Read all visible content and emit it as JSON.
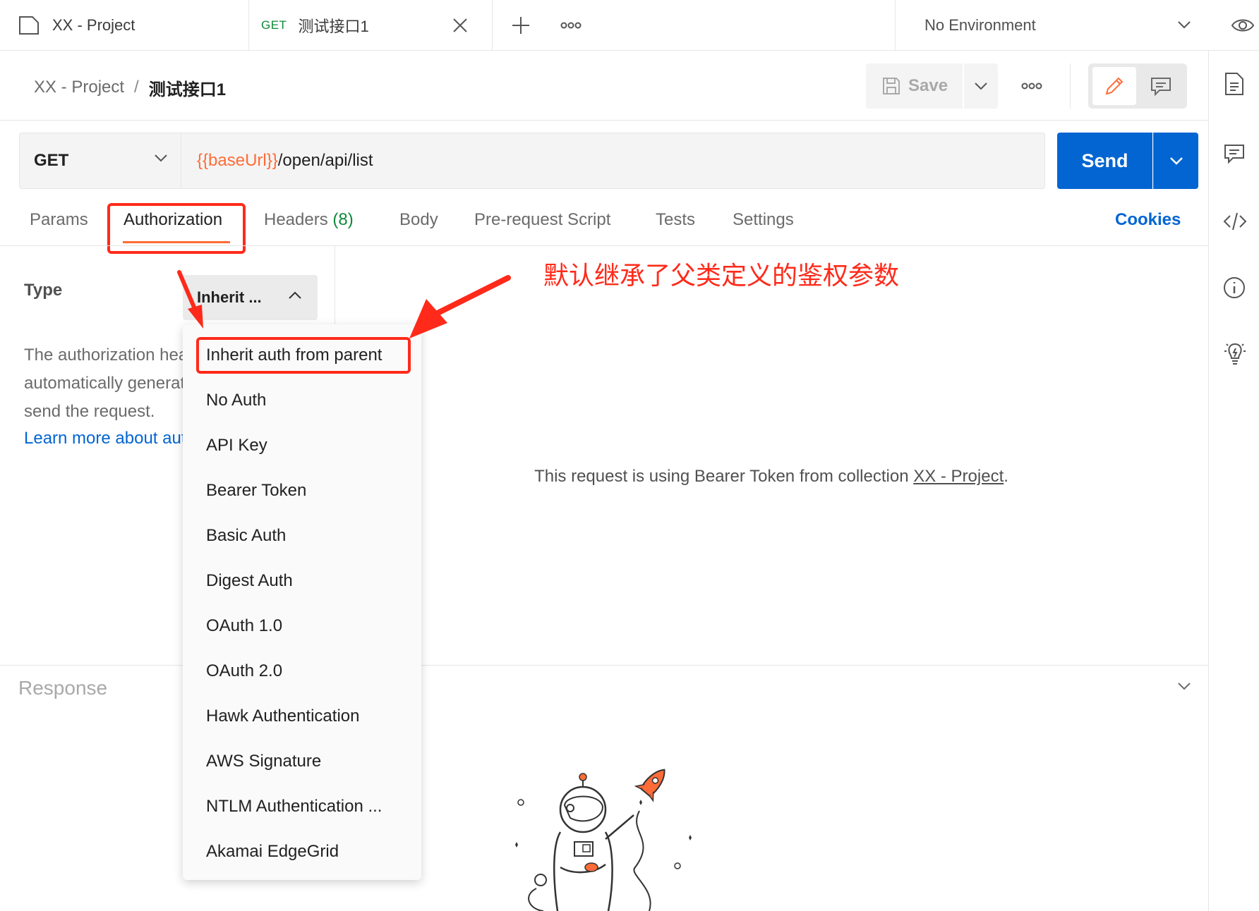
{
  "tabs": [
    {
      "label": "XX - Project"
    },
    {
      "method": "GET",
      "label": "测试接口1"
    }
  ],
  "environment": "No Environment",
  "breadcrumb": {
    "parent": "XX - Project",
    "separator": "/",
    "current": "测试接口1"
  },
  "toolbar": {
    "save_label": "Save"
  },
  "request": {
    "method": "GET",
    "url_variable": "{{baseUrl}}",
    "url_path": "/open/api/list",
    "send_label": "Send"
  },
  "request_tabs": [
    {
      "label": "Params"
    },
    {
      "label": "Authorization"
    },
    {
      "label": "Headers",
      "count": "(8)"
    },
    {
      "label": "Body"
    },
    {
      "label": "Pre-request Script"
    },
    {
      "label": "Tests"
    },
    {
      "label": "Settings"
    }
  ],
  "cookies_label": "Cookies",
  "auth": {
    "type_label": "Type",
    "type_value": "Inherit ...",
    "description_lines": [
      "The authorization header will be",
      "automatically generated when you",
      "send the request."
    ],
    "learn_more": "Learn more about authorization",
    "inherit_message_prefix": "This request is using Bearer Token from collection ",
    "inherit_message_link": "XX - Project",
    "inherit_message_suffix": "."
  },
  "auth_options": [
    "Inherit auth from parent",
    "No Auth",
    "API Key",
    "Bearer Token",
    "Basic Auth",
    "Digest Auth",
    "OAuth 1.0",
    "OAuth 2.0",
    "Hawk Authentication",
    "AWS Signature",
    "NTLM Authentication ...",
    "Akamai EdgeGrid"
  ],
  "annotation": "默认继承了父类定义的鉴权参数",
  "response_label": "Response",
  "colors": {
    "accent": "#ff6c37",
    "send": "#0265d2",
    "annotation": "#ff2a1a",
    "method_green": "#0f8a3a"
  },
  "icons": [
    "collection-icon",
    "close-icon",
    "plus-icon",
    "more-icon",
    "chevron-down-icon",
    "eye-icon",
    "save-icon",
    "pencil-icon",
    "comment-icon",
    "document-icon",
    "code-icon",
    "info-icon",
    "lightbulb-icon"
  ]
}
